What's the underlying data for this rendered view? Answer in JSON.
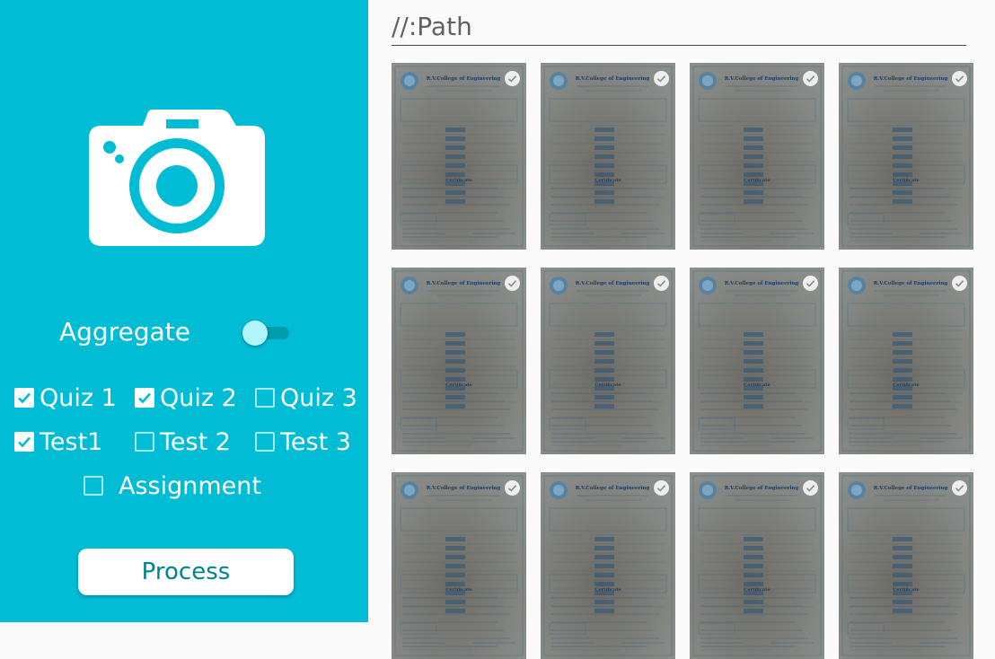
{
  "sidebar": {
    "camera_icon": "camera-icon",
    "aggregate_label": "Aggregate",
    "aggregate_on": false,
    "checkboxes": [
      {
        "label": "Quiz 1",
        "checked": true
      },
      {
        "label": "Quiz 2",
        "checked": true
      },
      {
        "label": "Quiz 3",
        "checked": false
      },
      {
        "label": "Test1",
        "checked": true
      },
      {
        "label": "Test 2",
        "checked": false
      },
      {
        "label": "Test 3",
        "checked": false
      },
      {
        "label": "Assignment",
        "checked": false
      }
    ],
    "process_label": "Process"
  },
  "path_input": {
    "placeholder": "//:Path",
    "value": ""
  },
  "gallery": {
    "doc_header": "R.V.College of Engineering",
    "doc_certificate": "Certificate",
    "items": [
      {
        "selected": true
      },
      {
        "selected": true
      },
      {
        "selected": true
      },
      {
        "selected": true
      },
      {
        "selected": true
      },
      {
        "selected": true
      },
      {
        "selected": true
      },
      {
        "selected": true
      },
      {
        "selected": true
      },
      {
        "selected": true
      },
      {
        "selected": true
      },
      {
        "selected": true
      }
    ]
  },
  "colors": {
    "accent": "#00bcd4",
    "panel_bg": "#fafafa",
    "button_text": "#00838f"
  }
}
